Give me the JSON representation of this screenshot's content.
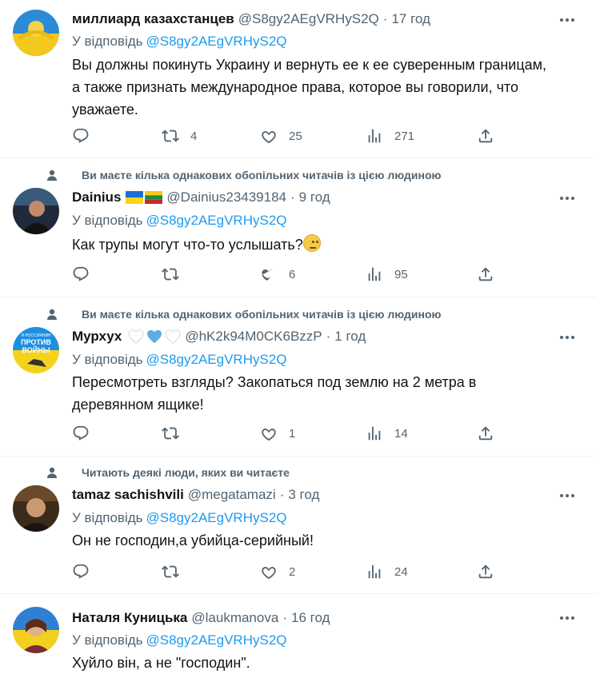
{
  "tweets": [
    {
      "context": "",
      "name": "миллиард казахстанцев",
      "handle": "@S8gy2AEgVRHyS2Q",
      "dot": "·",
      "time": "17 год",
      "reply_prefix": "У відповідь",
      "reply_to": "@S8gy2AEgVRHyS2Q",
      "lines": [
        "Вы должны покинуть Украину и вернуть ее к ее суверенным границам,",
        "а также признать международное права, которое вы говорили, что",
        "уважаете."
      ],
      "stats": {
        "replies": "",
        "retweets": "4",
        "likes": "25",
        "views": "271"
      }
    },
    {
      "context": "Ви маєте кілька однакових обопільних читачів із цією людиною",
      "name": "Dainius",
      "handle": "@Dainius23439184",
      "dot": "·",
      "time": "9 год",
      "reply_prefix": "У відповідь",
      "reply_to": "@S8gy2AEgVRHyS2Q",
      "lines": [
        "Как трупы могут что-то услышать?"
      ],
      "stats": {
        "replies": "",
        "retweets": "",
        "likes": "6",
        "views": "95"
      }
    },
    {
      "context": "Ви маєте кілька однакових обопільних читачів із цією людиною",
      "name": "Мурхух",
      "handle": "@hK2k94M0CK6BzzP",
      "dot": "·",
      "time": "1 год",
      "reply_prefix": "У відповідь",
      "reply_to": "@S8gy2AEgVRHyS2Q",
      "lines": [
        "Пересмотреть взгляды? Закопаться под землю на 2 метра в",
        "деревянном ящике!"
      ],
      "stats": {
        "replies": "",
        "retweets": "",
        "likes": "1",
        "views": "14"
      }
    },
    {
      "context": "Читають деякі люди, яких ви читаєте",
      "name": "tamaz sachishvili",
      "handle": "@megatamazi",
      "dot": "·",
      "time": "3 год",
      "reply_prefix": "У відповідь",
      "reply_to": "@S8gy2AEgVRHyS2Q",
      "lines": [
        "Он не господин,а убийца-серийный!"
      ],
      "stats": {
        "replies": "",
        "retweets": "",
        "likes": "2",
        "views": "24"
      }
    },
    {
      "context": "",
      "name": "Наталя Куницька",
      "handle": "@laukmanova",
      "dot": "·",
      "time": "16 год",
      "reply_prefix": "У відповідь",
      "reply_to": "@S8gy2AEgVRHyS2Q",
      "lines": [
        "Хуйло він, а не \"господин\"."
      ],
      "stats": {}
    }
  ],
  "avatar3_text": [
    "Я РОССИЯНИН",
    "ПРОТИВ",
    "ВОЙНЫ"
  ],
  "icons": {
    "more": "more-icon",
    "reply": "reply-icon",
    "retweet": "retweet-icon",
    "like": "heart-icon",
    "views": "views-icon",
    "share": "share-icon",
    "context": "person-icon"
  },
  "colors": {
    "mention": "#1d9bf0",
    "muted": "#536471",
    "text": "#0f1419",
    "divider": "#eff3f4"
  }
}
